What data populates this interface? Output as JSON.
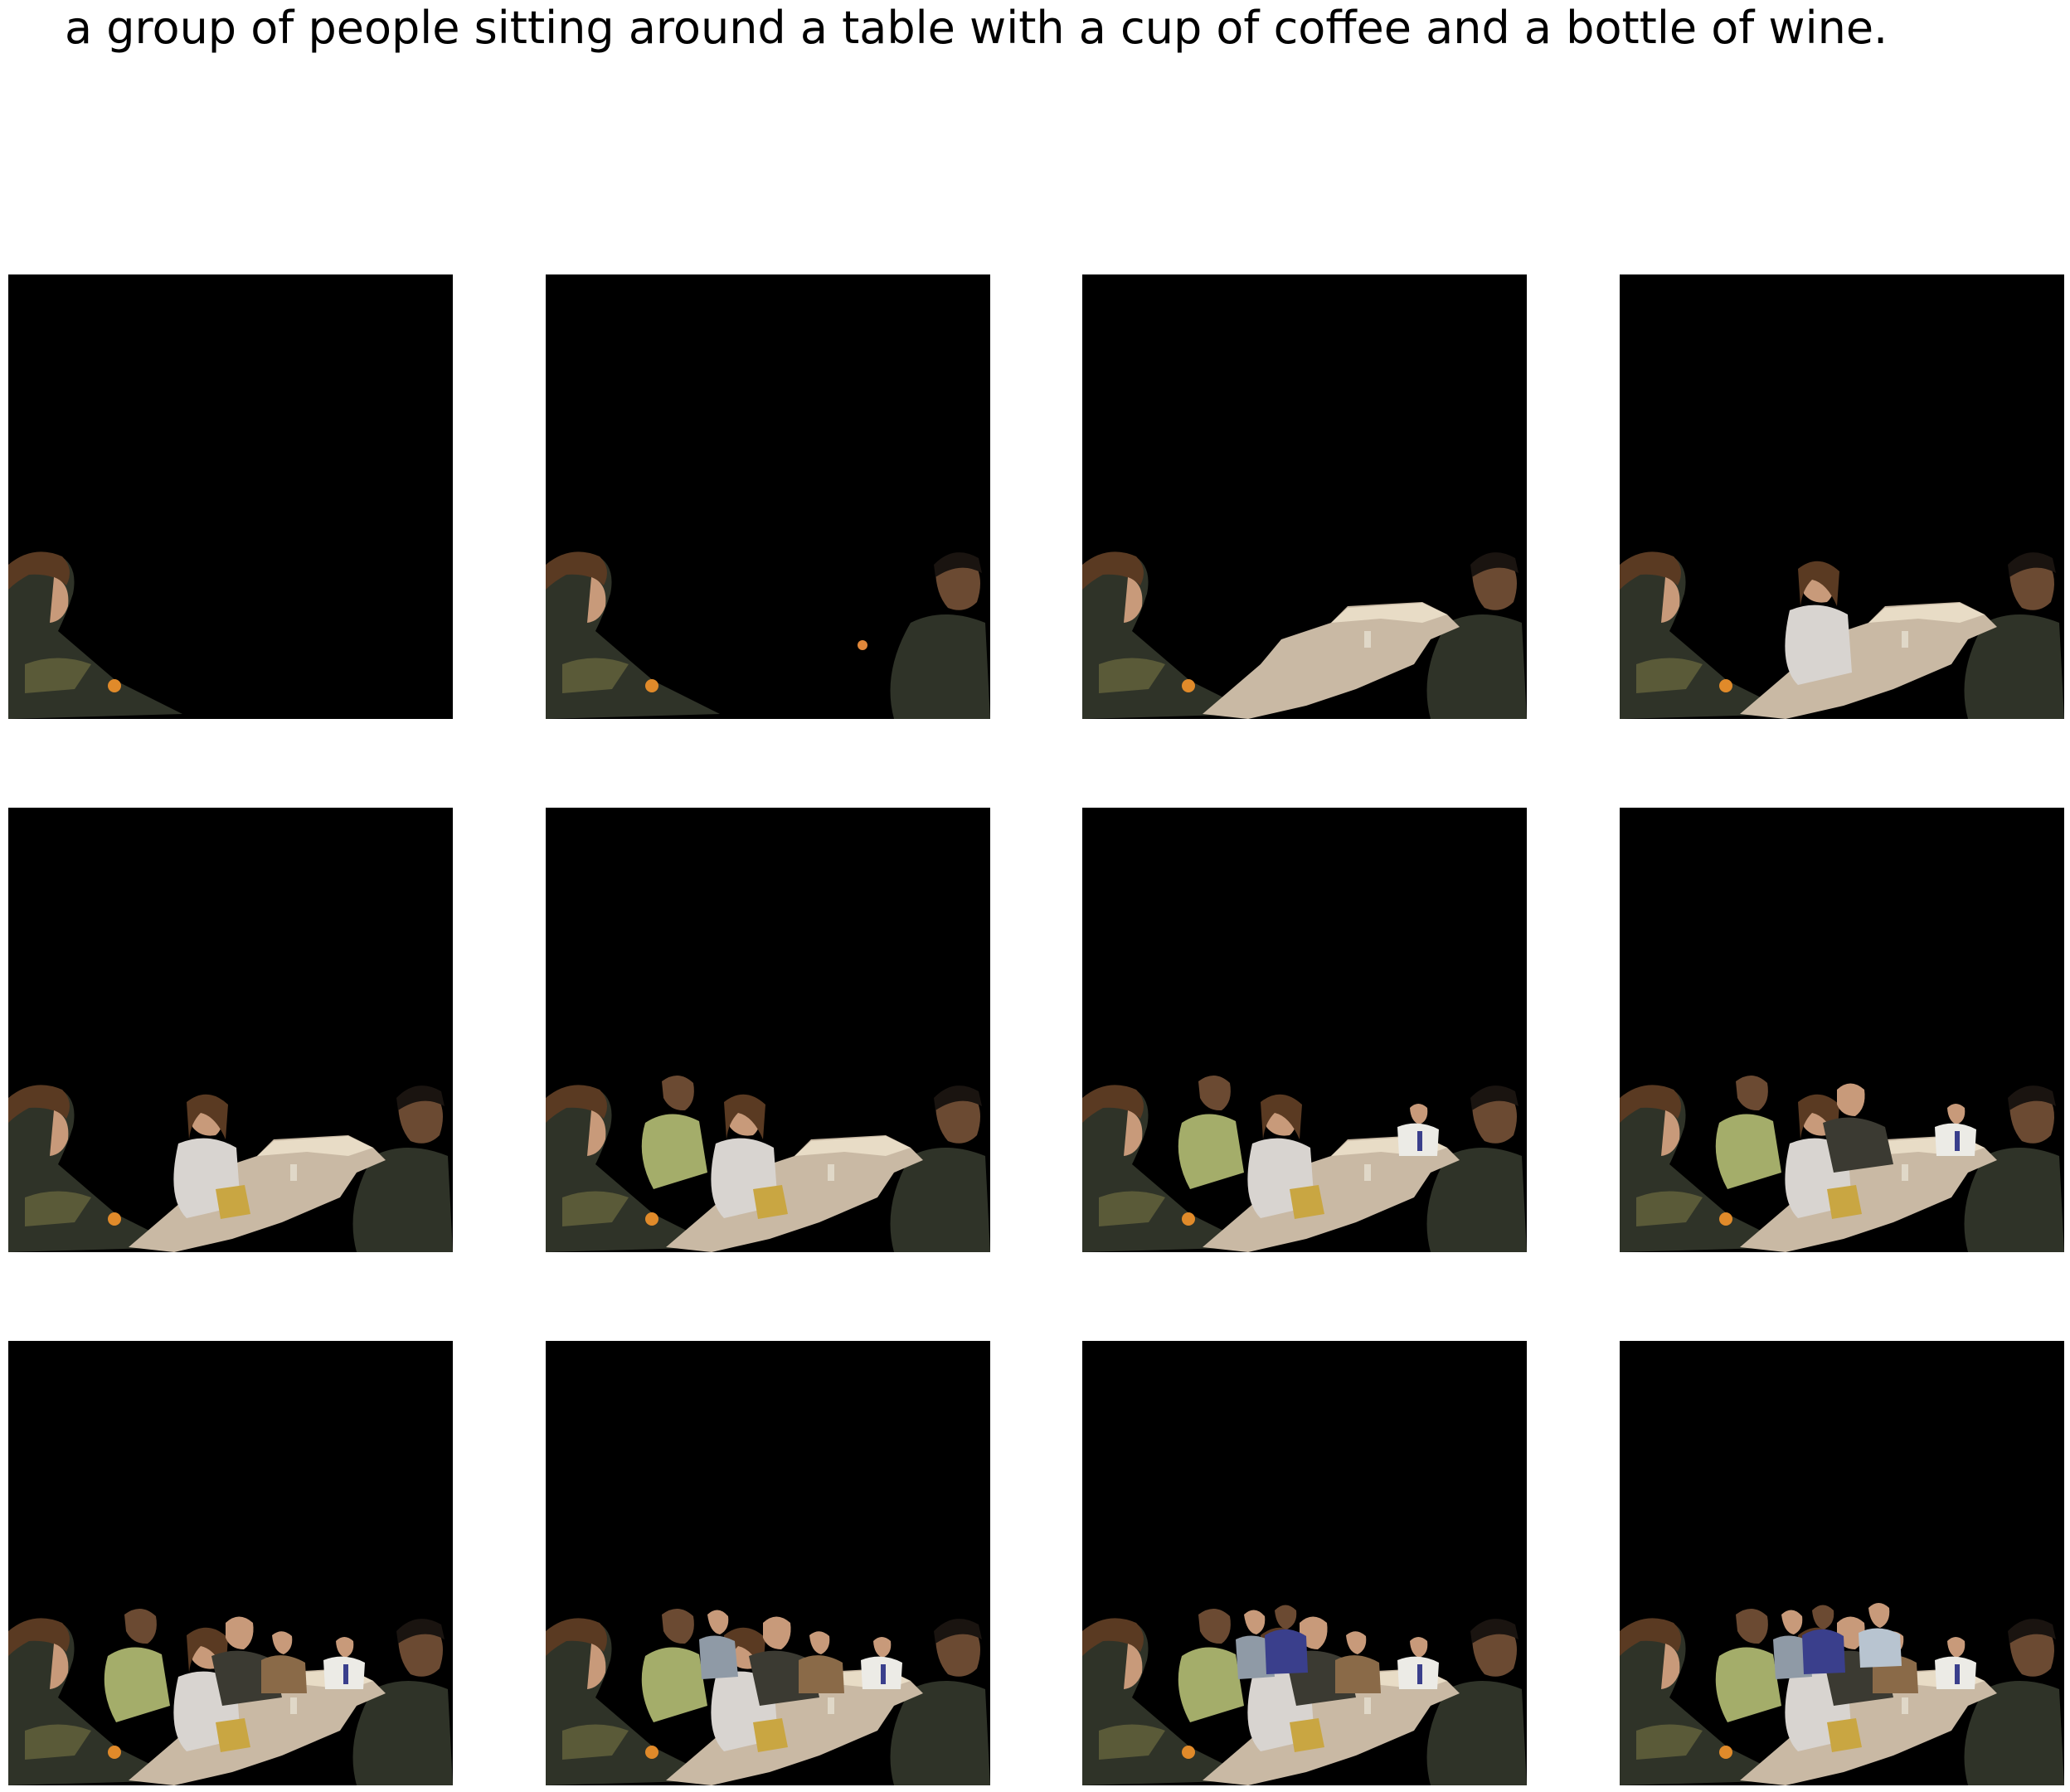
{
  "caption": "a group of people sitting around a table with a cup of coffee and a bottle of wine.",
  "colors": {
    "background": "#ffffff",
    "panel": "#000000",
    "hair": "#5a3a22",
    "skin_light": "#c89a7a",
    "skin_dark": "#6b4a32",
    "table_top": "#c9b9a4",
    "table_light": "#e8dcc6",
    "shirt_white": "#d8d4d0",
    "shirt_green": "#a4ad6a",
    "jacket_dark": "#2f3328",
    "olive": "#5a5a38",
    "gift_gold": "#c9a642",
    "blue": "#3a3f8c"
  },
  "panels": [
    {
      "id": 1,
      "segments": [
        "woman-left"
      ]
    },
    {
      "id": 2,
      "segments": [
        "woman-left",
        "man-right"
      ]
    },
    {
      "id": 3,
      "segments": [
        "woman-left",
        "man-right",
        "table"
      ]
    },
    {
      "id": 4,
      "segments": [
        "woman-left",
        "man-right",
        "table",
        "woman-center"
      ]
    },
    {
      "id": 5,
      "segments": [
        "woman-left",
        "man-right",
        "table",
        "woman-center",
        "gift"
      ]
    },
    {
      "id": 6,
      "segments": [
        "woman-left",
        "man-right",
        "table",
        "woman-center",
        "gift",
        "man-green"
      ]
    },
    {
      "id": 7,
      "segments": [
        "woman-left",
        "man-right",
        "table",
        "woman-center",
        "gift",
        "man-green",
        "man-white-shirt"
      ]
    },
    {
      "id": 8,
      "segments": [
        "woman-left",
        "man-right",
        "table",
        "woman-center",
        "gift",
        "man-green",
        "man-white-shirt",
        "man-beard"
      ]
    },
    {
      "id": 9,
      "segments": [
        "woman-left",
        "man-right",
        "table",
        "woman-center",
        "gift",
        "man-green",
        "man-white-shirt",
        "man-beard",
        "man-tan"
      ]
    },
    {
      "id": 10,
      "segments": [
        "woman-left",
        "man-right",
        "table",
        "woman-center",
        "gift",
        "man-green",
        "man-white-shirt",
        "man-beard",
        "man-tan",
        "woman-back"
      ]
    },
    {
      "id": 11,
      "segments": [
        "woman-left",
        "man-right",
        "table",
        "woman-center",
        "gift",
        "man-green",
        "man-white-shirt",
        "man-beard",
        "man-tan",
        "woman-back",
        "man-blue"
      ]
    },
    {
      "id": 12,
      "segments": [
        "woman-left",
        "man-right",
        "table",
        "woman-center",
        "gift",
        "man-green",
        "man-white-shirt",
        "man-beard",
        "man-tan",
        "woman-back",
        "man-blue",
        "woman-far"
      ]
    }
  ]
}
